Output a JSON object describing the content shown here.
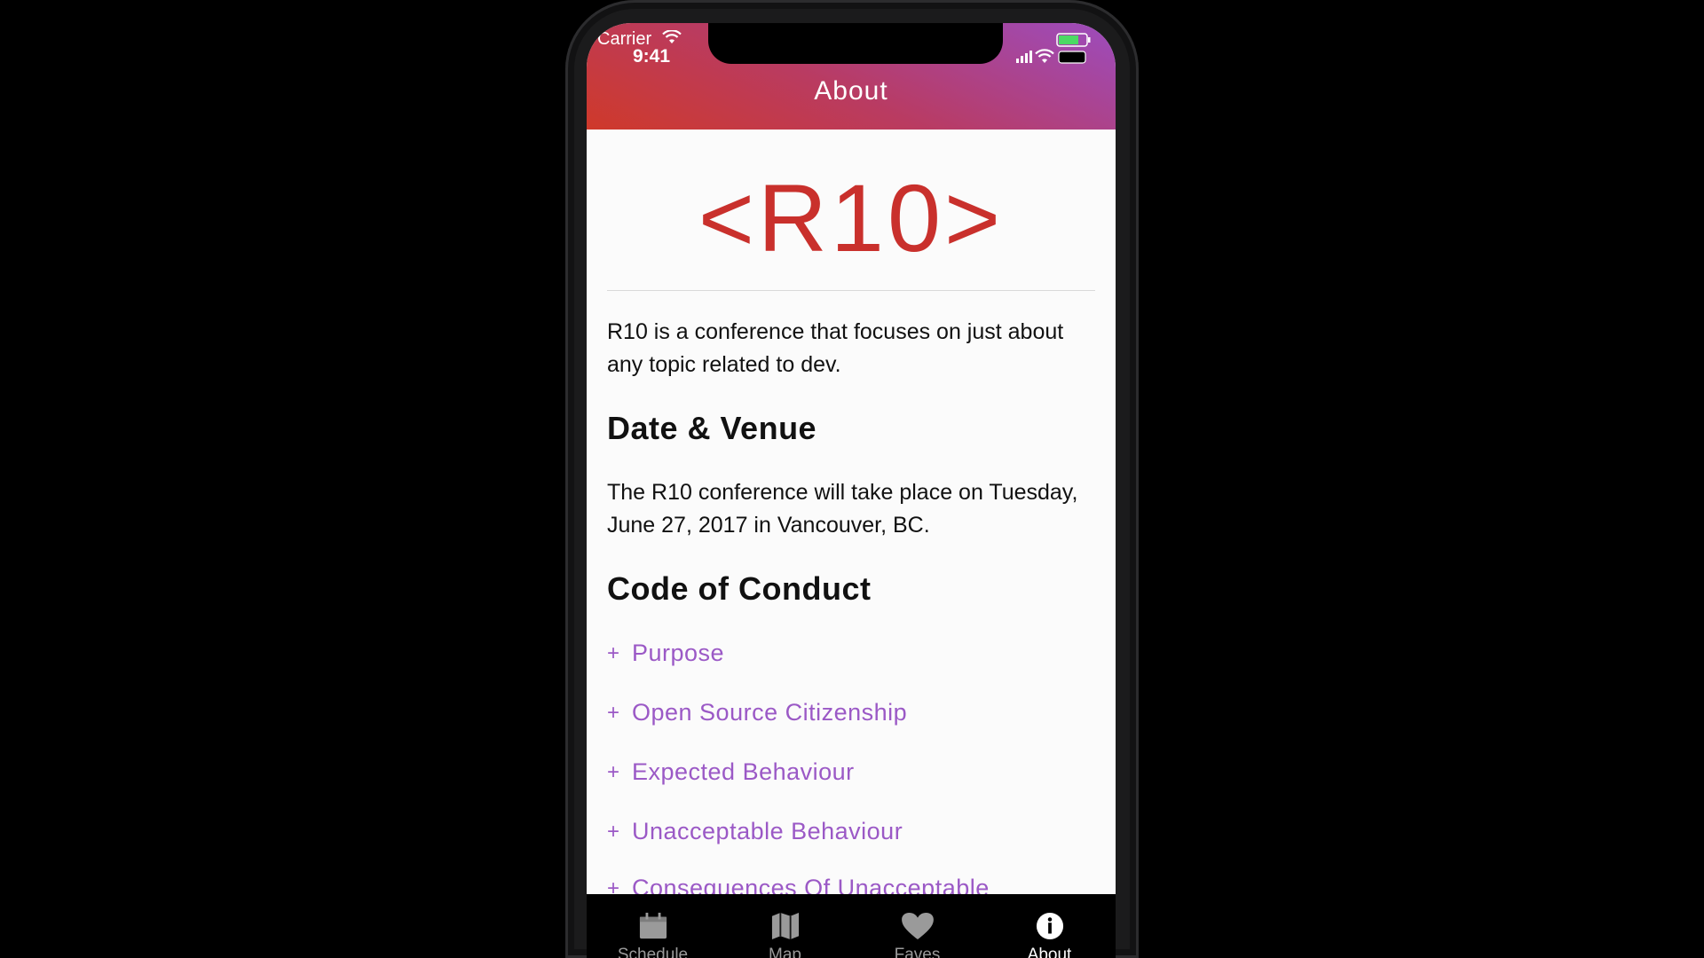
{
  "status_bar": {
    "carrier": "Carrier",
    "time": "9:41"
  },
  "header": {
    "title": "About"
  },
  "logo": {
    "text": "<R10>"
  },
  "intro": "R10 is a conference that focuses on just about any topic related to dev.",
  "sections": {
    "date_venue": {
      "title": "Date & Venue",
      "body": "The R10 conference will take place on Tuesday, June 27, 2017 in Vancouver, BC."
    },
    "code_of_conduct": {
      "title": "Code of Conduct",
      "items": [
        {
          "label": "Purpose"
        },
        {
          "label": "Open Source Citizenship"
        },
        {
          "label": "Expected Behaviour"
        },
        {
          "label": "Unacceptable Behaviour"
        },
        {
          "label": "Consequences Of Unacceptable"
        }
      ],
      "expand_symbol": "+"
    }
  },
  "tabs": [
    {
      "label": "Schedule",
      "icon": "calendar-icon",
      "active": false
    },
    {
      "label": "Map",
      "icon": "map-icon",
      "active": false
    },
    {
      "label": "Faves",
      "icon": "heart-icon",
      "active": false
    },
    {
      "label": "About",
      "icon": "info-icon",
      "active": true
    }
  ],
  "colors": {
    "brand_red": "#c9302c",
    "accent_purple": "#9b59c6",
    "header_gradient": [
      "#cf392a",
      "#9c4cbe"
    ]
  }
}
